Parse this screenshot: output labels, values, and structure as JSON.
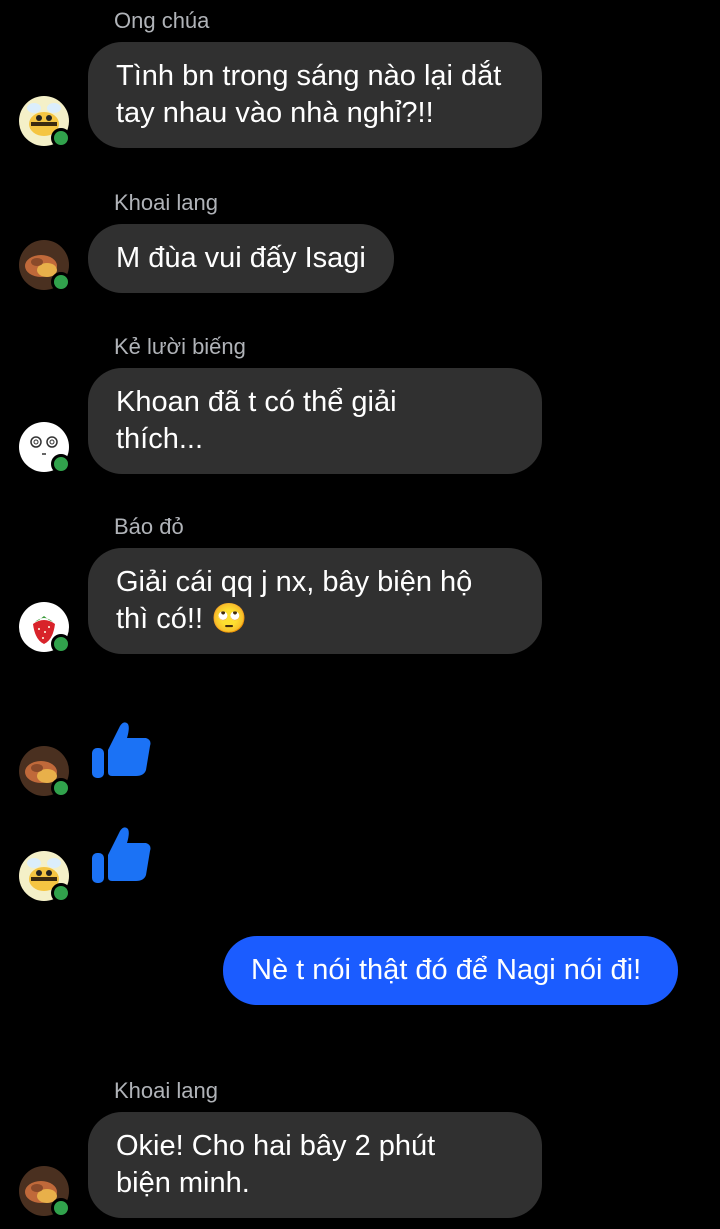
{
  "messages": [
    {
      "sender": "Ong chúa",
      "text": "Tình bn trong sáng nào lại dắt tay nhau vào nhà nghỉ?!!"
    },
    {
      "sender": "Khoai lang",
      "text": "M đùa vui đấy Isagi"
    },
    {
      "sender": "Kẻ lười biếng",
      "text": "Khoan đã t có thể giải thích..."
    },
    {
      "sender": "Báo đỏ",
      "text": "Giải cái qq j nx, bây biện hộ thì có!! 🙄"
    },
    {
      "sender": "Khoai lang",
      "text": "Okie! Cho hai bây 2 phút biện minh."
    }
  ],
  "own_message": {
    "text": "Nè t nói thật đó để Nagi nói đi!"
  },
  "reactions": [
    {
      "icon": "thumbs-up-icon"
    },
    {
      "icon": "thumbs-up-icon"
    }
  ],
  "colors": {
    "own_bubble": "#1b5cff",
    "other_bubble": "#303030",
    "online": "#31a24c"
  }
}
